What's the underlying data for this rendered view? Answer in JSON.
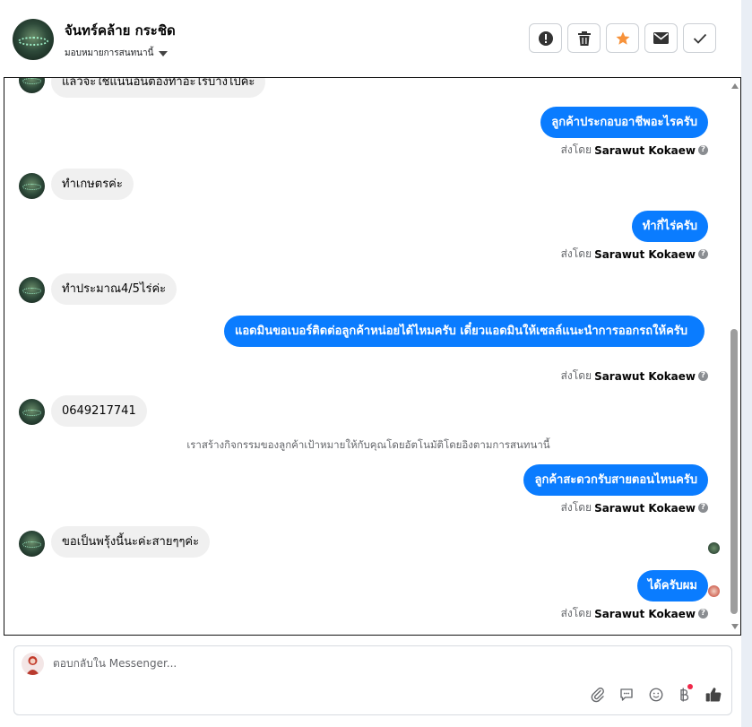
{
  "header": {
    "contact_name": "จันทร์คล้าย กระชิด",
    "assign_label": "มอบหมายการสนทนานี้",
    "actions": [
      {
        "name": "report-icon",
        "color": "#333333"
      },
      {
        "name": "trash-icon",
        "color": "#333333"
      },
      {
        "name": "star-icon",
        "color": "#f7923a"
      },
      {
        "name": "envelope-icon",
        "color": "#333333"
      },
      {
        "name": "check-icon",
        "color": "#333333"
      }
    ]
  },
  "colors": {
    "outgoing_bubble": "#0a7cff",
    "incoming_bubble": "#f0f0f0",
    "star": "#f7923a",
    "notification_dot": "#f02849"
  },
  "messages": [
    {
      "dir": "in",
      "text": "แล้วจะใช้แน่นอนต้องทำอะไรบ้างไปคะ"
    },
    {
      "dir": "out",
      "text": "ลูกค้าประกอบอาชีพอะไรครับ"
    },
    {
      "dir": "in",
      "text": "ทำเกษตรค่ะ"
    },
    {
      "dir": "out",
      "text": "ทำกี่ไร่ครับ"
    },
    {
      "dir": "in",
      "text": "ทำประมาณ4/5ไร่ค่ะ"
    },
    {
      "dir": "out",
      "text": "แอดมินขอเบอร์ติดต่อลูกค้าหน่อยได้ไหมครับ เดี๋ยวแอดมินให้เซลล์แนะนำการออกรถให้ครับ"
    },
    {
      "dir": "in",
      "text": "0649217741"
    },
    {
      "dir": "out",
      "text": "ลูกค้าสะดวกรับสายตอนไหนครับ"
    },
    {
      "dir": "in",
      "text": "ขอเป็นพรุ้งนี้นะค่ะสายๆๆค่ะ"
    },
    {
      "dir": "out",
      "text": "ได้ครับผม"
    }
  ],
  "sent_by": {
    "prefix": "ส่งโดย",
    "agent": "Sarawut Kokaew",
    "help": "?"
  },
  "system_note": "เราสร้างกิจกรรมของลูกค้าเป้าหมายให้กับคุณโดยอัตโนมัติโดยอิงตามการสนทนานี้",
  "composer": {
    "placeholder": "ตอบกลับใน Messenger...",
    "tools": [
      "paperclip-icon",
      "comment-icon",
      "emoji-icon",
      "baht-icon",
      "thumbs-up-icon"
    ]
  }
}
